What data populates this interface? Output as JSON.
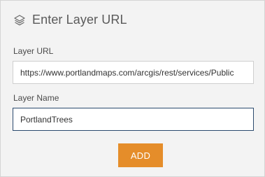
{
  "dialog": {
    "title": "Enter Layer URL",
    "icon": "layers-icon"
  },
  "layer_url": {
    "label": "Layer URL",
    "value": "https://www.portlandmaps.com/arcgis/rest/services/Public"
  },
  "layer_name": {
    "label": "Layer Name",
    "value": "PortlandTrees"
  },
  "actions": {
    "add_label": "ADD",
    "add_color": "#e58d2a"
  }
}
